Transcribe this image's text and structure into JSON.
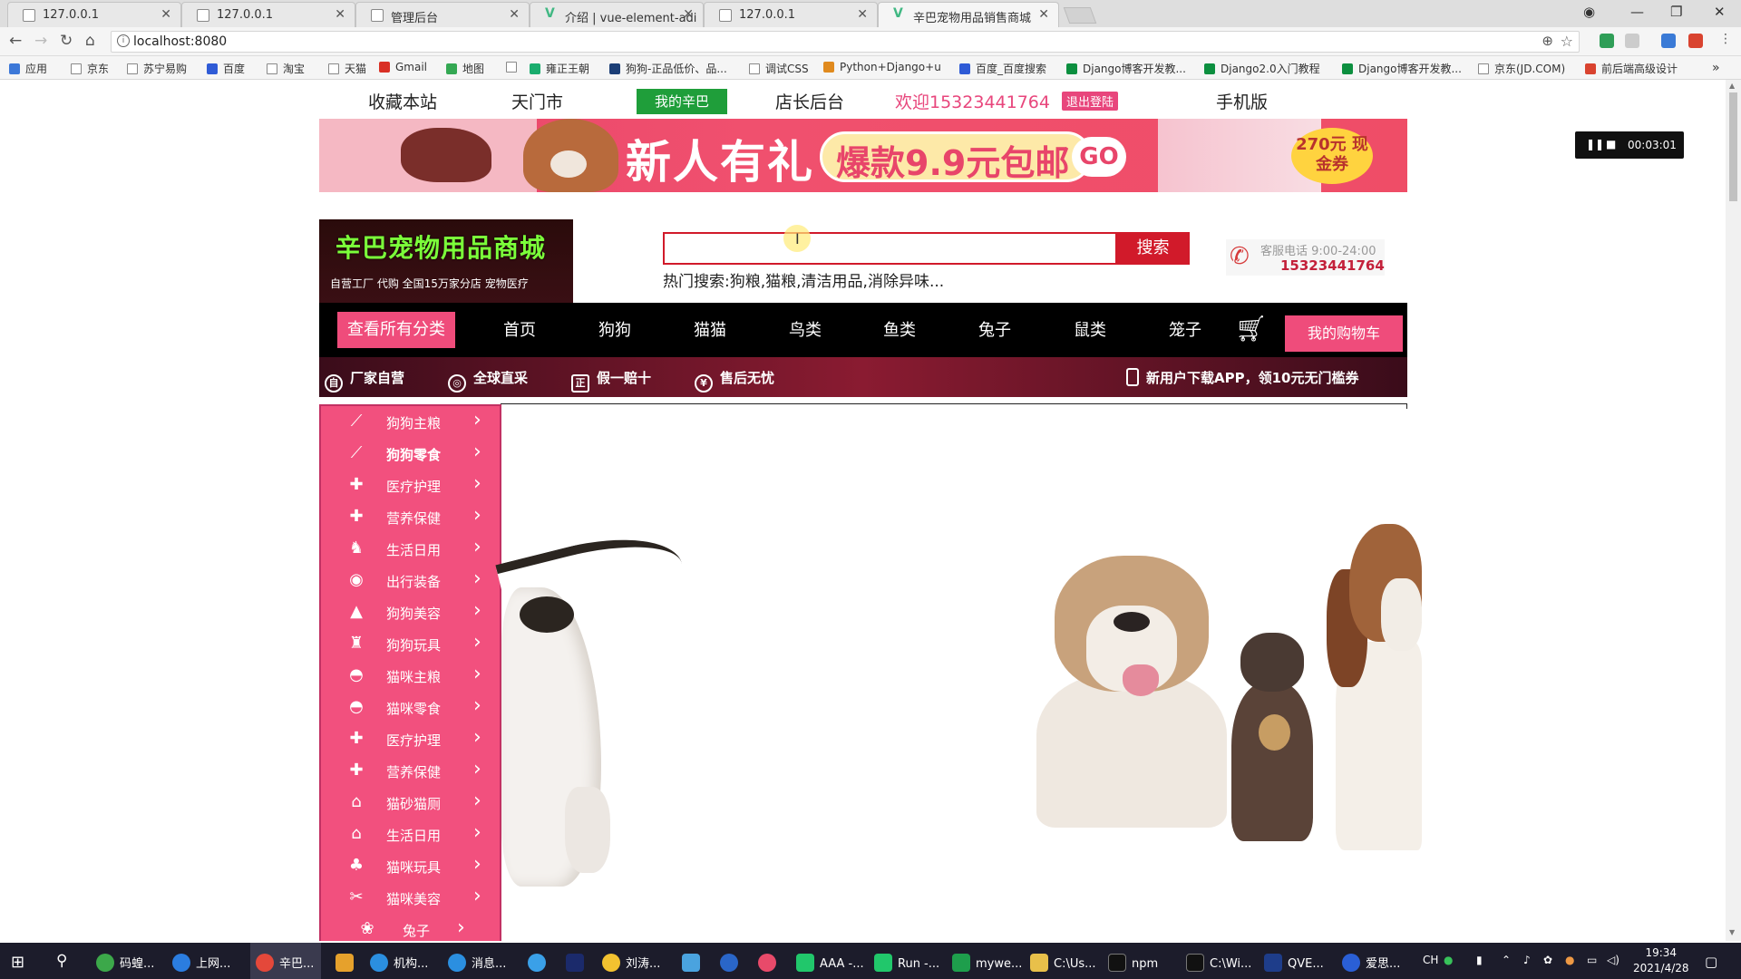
{
  "browser": {
    "tabs": [
      {
        "title": "127.0.0.1",
        "icon": "page-icon"
      },
      {
        "title": "127.0.0.1",
        "icon": "page-icon"
      },
      {
        "title": "管理后台",
        "icon": "page-icon"
      },
      {
        "title": "介绍 | vue-element-adi",
        "icon": "vue-icon"
      },
      {
        "title": "127.0.0.1",
        "icon": "page-icon"
      },
      {
        "title": "辛巴宠物用品销售商城",
        "icon": "vue-icon"
      }
    ],
    "url": "localhost:8080",
    "bookmarks": [
      "应用",
      "京东",
      "苏宁易购",
      "百度",
      "淘宝",
      "天猫",
      "Gmail",
      "地图",
      "",
      "雍正王朝",
      "狗狗-正品低价、品...",
      "调试CSS",
      "Python+Django+u",
      "百度_百度搜索",
      "Django博客开发教...",
      "Django2.0入门教程",
      "Django博客开发教...",
      "京东(JD.COM)",
      "前后端高级设计"
    ]
  },
  "site": {
    "top_nav": {
      "favorite": "收藏本站",
      "city": "天门市",
      "mine": "我的辛巴",
      "admin": "店长后台",
      "welcome": "欢迎15323441764",
      "logout": "退出登陆",
      "mobile": "手机版"
    },
    "banner": {
      "headline": "新人有礼",
      "promo": "爆款9.9元包邮",
      "go": "GO",
      "coupon": "270元 现金券"
    },
    "logo": {
      "title": "辛巴宠物用品商城",
      "tagline": "自营工厂    代购    全国15万家分店    宠物医疗"
    },
    "search": {
      "value": "",
      "button": "搜索",
      "hot": "热门搜索:狗粮,猫粮,清洁用品,消除异味..."
    },
    "service": {
      "label": "客服电话  9:00-24:00",
      "phone": "15323441764"
    },
    "categories": {
      "all": "查看所有分类",
      "items": [
        "首页",
        "狗狗",
        "猫猫",
        "鸟类",
        "鱼类",
        "兔子",
        "鼠类",
        "笼子"
      ],
      "cart": "我的购物车"
    },
    "promo_bar": [
      "厂家自营",
      "全球直采",
      "假一赔十",
      "售后无忧",
      "新用户下载APP，领10元无门槛券"
    ],
    "sidebar": [
      {
        "label": "狗狗主粮",
        "icon": "bone-icon"
      },
      {
        "label": "狗狗零食",
        "icon": "bone-icon"
      },
      {
        "label": "医疗护理",
        "icon": "medical-icon"
      },
      {
        "label": "营养保健",
        "icon": "medical-icon"
      },
      {
        "label": "生活日用",
        "icon": "dog-icon"
      },
      {
        "label": "出行装备",
        "icon": "bag-icon"
      },
      {
        "label": "狗狗美容",
        "icon": "clothes-icon"
      },
      {
        "label": "狗狗玩具",
        "icon": "toy-icon"
      },
      {
        "label": "猫咪主粮",
        "icon": "bowl-icon"
      },
      {
        "label": "猫咪零食",
        "icon": "bowl-icon"
      },
      {
        "label": "医疗护理",
        "icon": "medical-icon"
      },
      {
        "label": "营养保健",
        "icon": "medical-icon"
      },
      {
        "label": "猫砂猫厕",
        "icon": "house-icon"
      },
      {
        "label": "生活日用",
        "icon": "house-icon"
      },
      {
        "label": "猫咪玩具",
        "icon": "toy-icon"
      },
      {
        "label": "猫咪美容",
        "icon": "scissors-icon"
      },
      {
        "label": "兔子",
        "icon": "rabbit-icon"
      }
    ]
  },
  "recording": {
    "time": "00:03:01"
  },
  "taskbar": {
    "apps": [
      "码蝗...",
      "上网...",
      "辛巴...",
      "",
      "机构...",
      "消息...",
      "",
      "",
      "刘涛...",
      "",
      "",
      "",
      "AAA -...",
      "Run -...",
      "mywe...",
      "C:\\Us...",
      "npm",
      "C:\\Wi...",
      "QVE...",
      "爱思..."
    ],
    "time": "19:34",
    "date": "2021/4/28",
    "ime": "CH"
  }
}
